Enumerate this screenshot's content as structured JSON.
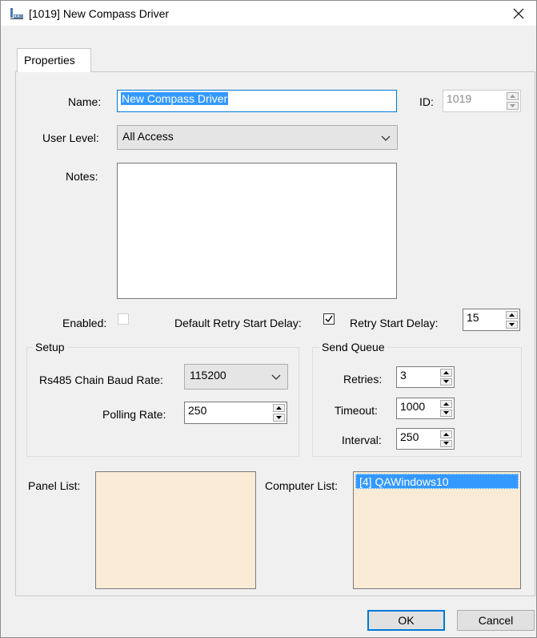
{
  "window": {
    "title": "[1019] New Compass Driver",
    "close_glyph": "✕"
  },
  "tabs": [
    {
      "label": "Properties"
    }
  ],
  "form": {
    "name_label": "Name:",
    "name_value": "New Compass Driver",
    "id_label": "ID:",
    "id_value": "1019",
    "user_level_label": "User Level:",
    "user_level_value": "All Access",
    "notes_label": "Notes:",
    "notes_value": "",
    "enabled_label": "Enabled:",
    "enabled_checked": false,
    "default_retry_label": "Default Retry Start Delay:",
    "default_retry_checked": true,
    "retry_delay_label": "Retry Start Delay:",
    "retry_delay_value": "15"
  },
  "setup": {
    "title": "Setup",
    "baud_label": "Rs485 Chain Baud Rate:",
    "baud_value": "115200",
    "polling_label": "Polling Rate:",
    "polling_value": "250"
  },
  "send_queue": {
    "title": "Send Queue",
    "retries_label": "Retries:",
    "retries_value": "3",
    "timeout_label": "Timeout:",
    "timeout_value": "1000",
    "interval_label": "Interval:",
    "interval_value": "250"
  },
  "lists": {
    "panel_label": "Panel List:",
    "computer_label": "Computer List:",
    "computer_items": [
      "[4] QAWindows10"
    ]
  },
  "buttons": {
    "ok": "OK",
    "cancel": "Cancel"
  },
  "colors": {
    "list_background": "#faebd7",
    "selection": "#3399ff",
    "focus_border": "#0078d7"
  }
}
